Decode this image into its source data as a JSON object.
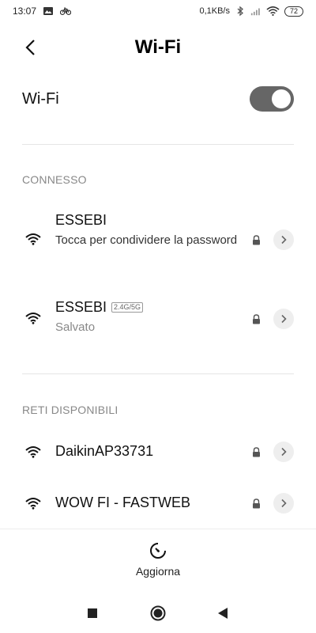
{
  "status_bar": {
    "time": "13:07",
    "left_icons": [
      "gallery-icon",
      "bike-icon"
    ],
    "network_speed": "0,1KB/s",
    "right_icons": [
      "bluetooth-icon",
      "signal-icon",
      "wifi-icon"
    ],
    "battery": "72"
  },
  "header": {
    "title": "Wi-Fi",
    "back_icon": "chevron-left-icon"
  },
  "wifi_toggle": {
    "label": "Wi-Fi",
    "enabled": true
  },
  "connected_section": {
    "title": "CONNESSO",
    "networks": [
      {
        "name": "ESSEBI",
        "subtitle": "Tocca per condividere la password",
        "tag": "",
        "secured": true
      },
      {
        "name": "ESSEBI",
        "subtitle": "Salvato",
        "tag": "2.4G/5G",
        "secured": true
      }
    ]
  },
  "available_section": {
    "title": "RETI DISPONIBILI",
    "networks": [
      {
        "name": "DaikinAP33731",
        "secured": true
      },
      {
        "name": "WOW FI - FASTWEB",
        "secured": true
      }
    ]
  },
  "refresh": {
    "label": "Aggiorna",
    "icon": "refresh-gauge-icon"
  },
  "nav_bar": {
    "icons": [
      "recents-square-icon",
      "home-circle-icon",
      "back-triangle-icon"
    ]
  }
}
